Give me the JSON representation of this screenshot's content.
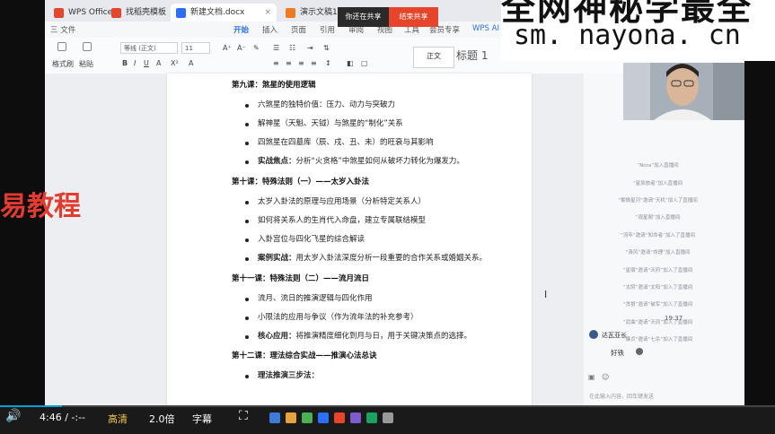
{
  "wps": {
    "tabs": [
      {
        "label": "WPS Office",
        "color": "#e6452b"
      },
      {
        "label": "找稻壳模板",
        "color": "#e6452b"
      },
      {
        "label": "新建文档.docx",
        "color": "#2b6ff7"
      },
      {
        "label": "演示文稿1",
        "color": "#f07a22"
      }
    ],
    "menu": [
      "三 文件",
      "开始",
      "插入",
      "页面",
      "引用",
      "审阅",
      "视图",
      "工具",
      "会员专享",
      "WPS AI"
    ],
    "toolbar": {
      "format_painter": "格式刷",
      "paste": "粘贴",
      "font": "等线 (正文)",
      "size": "11",
      "style_box": "正文",
      "heading": "标题 1"
    }
  },
  "live": {
    "hint": "你还在共享",
    "button": "结束共享"
  },
  "watermark": {
    "top": "全网神秘学最全",
    "url": "sm. nayona. cn",
    "left": "易教程"
  },
  "doc": {
    "sections": [
      {
        "title": "第九课：煞星的使用逻辑",
        "items": [
          {
            "bold": "",
            "text": "六煞星的独特价值：压力、动力与突破力"
          },
          {
            "bold": "",
            "text": "解神星（天魁、天钺）与煞星的“制化”关系"
          },
          {
            "bold": "",
            "text": "四煞星在四墓库（辰、戌、丑、未）的旺衰与其影响"
          },
          {
            "bold": "实战焦点：",
            "text": "分析“火贪格”中煞星如何从破坏力转化为爆发力。"
          }
        ]
      },
      {
        "title": "第十课：特殊法则（一）——太岁入卦法",
        "items": [
          {
            "bold": "",
            "text": "太岁入卦法的原理与应用场景（分析特定关系人）"
          },
          {
            "bold": "",
            "text": "如何将关系人的生肖代入命盘，建立专属联结模型"
          },
          {
            "bold": "",
            "text": "入卦宫位与四化飞星的综合解读"
          },
          {
            "bold": "案例实战：",
            "text": "用太岁入卦法深度分析一段重要的合作关系或婚姻关系。"
          }
        ]
      },
      {
        "title": "第十一课：特殊法则（二）——流月流日",
        "items": [
          {
            "bold": "",
            "text": "流月、流日的推演逻辑与四化作用"
          },
          {
            "bold": "",
            "text": "小限法的应用与争议（作为流年法的补充参考）"
          },
          {
            "bold": "核心应用：",
            "text": "将推演精度细化到月与日，用于关键决策点的选择。"
          }
        ]
      },
      {
        "title": "第十二课：理法综合实战——推演心法总诀",
        "items": [
          {
            "bold": "理法推演三步法：",
            "text": ""
          }
        ]
      }
    ]
  },
  "chat": {
    "messages": [
      "“Nora”加入直播间",
      "“星辰旅者”加入直播间",
      "“紫微星河”邀请“天机”加入了直播间",
      "“观星阁”加入直播间",
      "“流年”邀请“知命者”加入了直播间",
      "“清风”邀请“命理”加入直播间",
      "“星宿”邀请“天府”加入了直播间",
      "“太阴”邀请“太阳”加入了直播间",
      "“贪狼”邀请“破军”加入了直播间",
      "“武曲”邀请“天同”加入了直播间",
      "“廉贞”邀请“七杀”加入了直播间"
    ],
    "time": "19:37",
    "host": "达瓦亚长",
    "reply": "好铁",
    "input_placeholder": "在此输入内容，回车键发送"
  },
  "player": {
    "time": "4:46 / -:--",
    "quality": "高清",
    "speed": "2.0倍",
    "subtitle": "字幕",
    "progress": 0.08
  }
}
